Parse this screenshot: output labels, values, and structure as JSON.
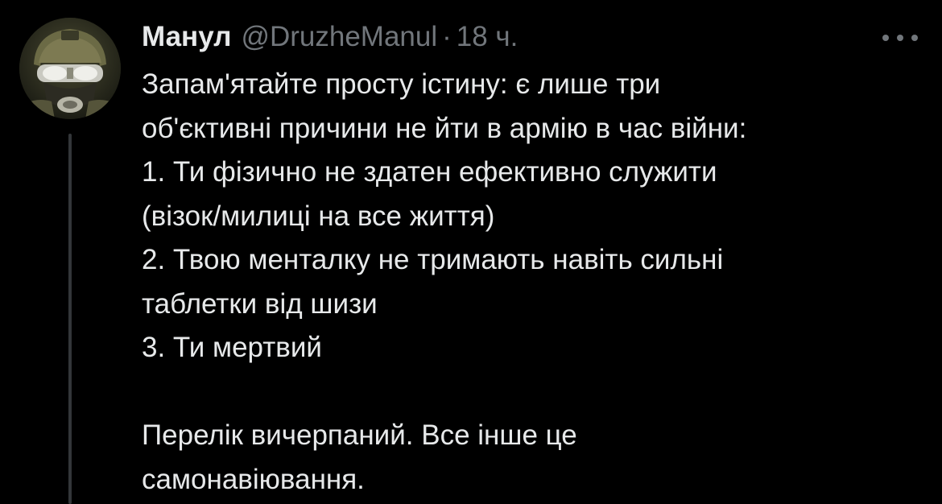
{
  "tweet": {
    "author": {
      "display_name": "Манул",
      "handle": "@DruzheManul",
      "avatar_icon": "soldier-avatar-icon"
    },
    "separator": "·",
    "time": "18 ч.",
    "more_icon": "more-options-icon",
    "text": {
      "line1": "Запам'ятайте просту істину: є лише три",
      "line2": "об'єктивні причини не йти в армію в час війни:",
      "line3": "1. Ти фізично не здатен ефективно служити",
      "line4": "(візок/милиці на все життя)",
      "line5": "2. Твою менталку не тримають навіть сильні",
      "line6": "таблетки від шизи",
      "line7": "3. Ти мертвий",
      "line8": "Перелік вичерпаний. Все інше це",
      "line9": "самонавіювання."
    }
  },
  "colors": {
    "background": "#000000",
    "primary_text": "#e7e9ea",
    "secondary_text": "#71767b",
    "thread_line": "#333639"
  }
}
